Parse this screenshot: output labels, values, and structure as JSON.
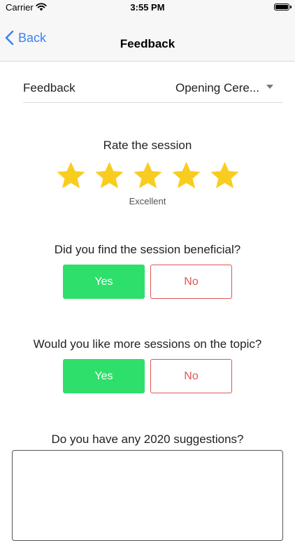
{
  "status": {
    "carrier": "Carrier",
    "time": "3:55 PM"
  },
  "nav": {
    "back_label": "Back",
    "title": "Feedback"
  },
  "form": {
    "feedback_label": "Feedback",
    "session_value": "Opening Cere...",
    "rating": {
      "heading": "Rate the session",
      "stars_filled": 5,
      "stars_total": 5,
      "label": "Excellent",
      "star_color": "#f9cc20"
    },
    "questions": [
      {
        "text": "Did you find the session beneficial?",
        "yes_label": "Yes",
        "no_label": "No",
        "selected": "Yes"
      },
      {
        "text": "Would you like more sessions on the topic?",
        "yes_label": "Yes",
        "no_label": "No",
        "selected": "Yes"
      }
    ],
    "suggestions_heading": "Do you have any 2020 suggestions?",
    "suggestions_value": ""
  },
  "colors": {
    "accent": "#3b82f6",
    "yes": "#2ee06b",
    "no": "#e25555"
  }
}
